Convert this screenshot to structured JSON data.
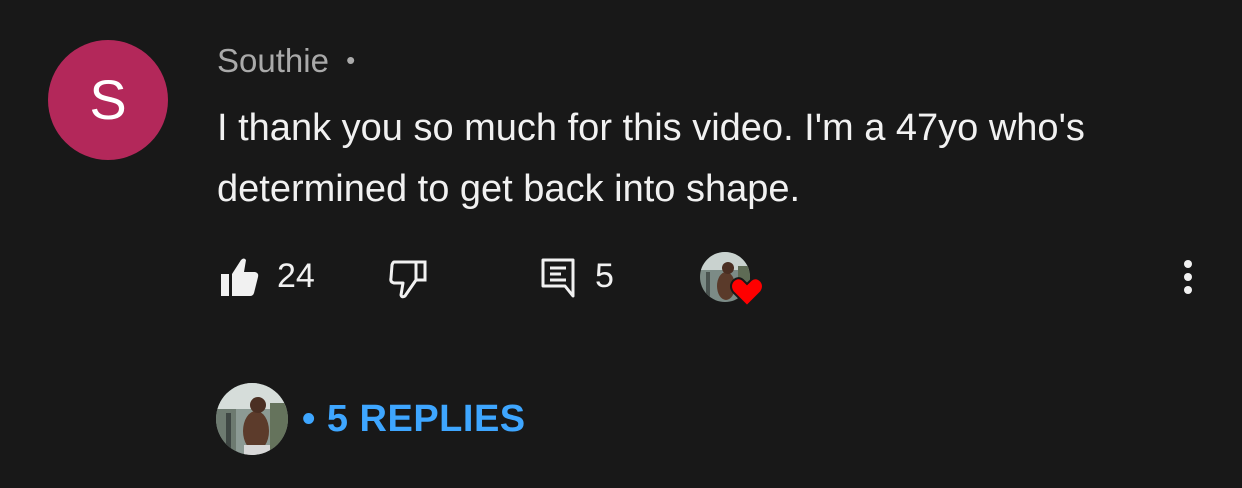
{
  "comment": {
    "avatar_letter": "S",
    "avatar_color": "#b3285a",
    "author": "Southie",
    "separator": "•",
    "text": "I thank you so much for this video. I'm a 47yo who's determined to get back into shape.",
    "like_count": "24",
    "reply_count": "5",
    "replies_link": "• 5 REPLIES",
    "accent_color": "#3ea6ff",
    "icons": [
      "thumbs-up-icon",
      "thumbs-down-icon",
      "comment-icon",
      "heart-icon",
      "more-vert-icon"
    ]
  }
}
